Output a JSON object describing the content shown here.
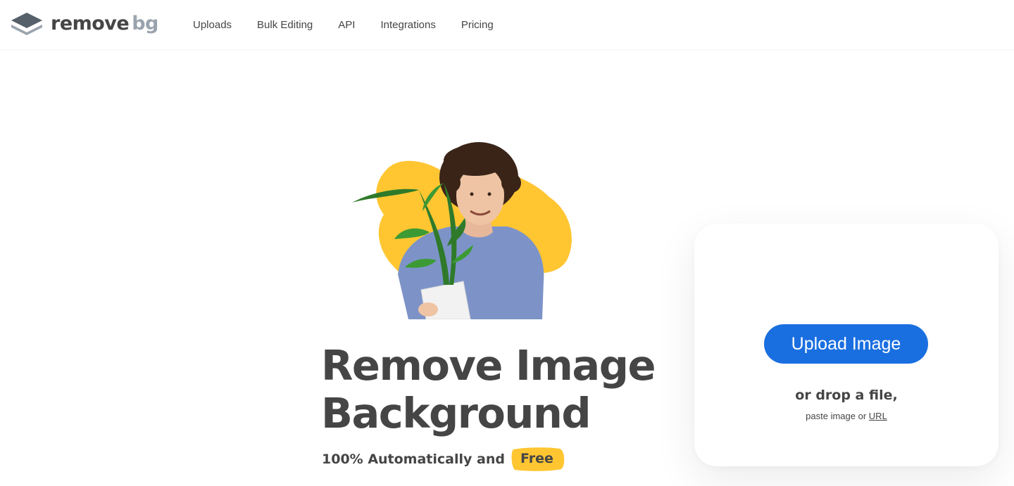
{
  "logo": {
    "word1": "remove",
    "word2": "bg",
    "icon": "layers-icon"
  },
  "nav": {
    "items": [
      {
        "label": "Uploads"
      },
      {
        "label": "Bulk Editing"
      },
      {
        "label": "API"
      },
      {
        "label": "Integrations"
      },
      {
        "label": "Pricing"
      }
    ]
  },
  "hero": {
    "headline_line1": "Remove Image",
    "headline_line2": "Background",
    "subline_prefix": "100% Automatically and",
    "subline_highlight": "Free",
    "illustration": "person-holding-plant-image"
  },
  "upload": {
    "button_label": "Upload Image",
    "drop_text": "or drop a file,",
    "paste_prefix": "paste image or",
    "url_link": "URL"
  },
  "colors": {
    "primary": "#1a6fe0",
    "text": "#454545",
    "accent_yellow": "#ffc632",
    "logo_gray": "#9aa3ad"
  }
}
